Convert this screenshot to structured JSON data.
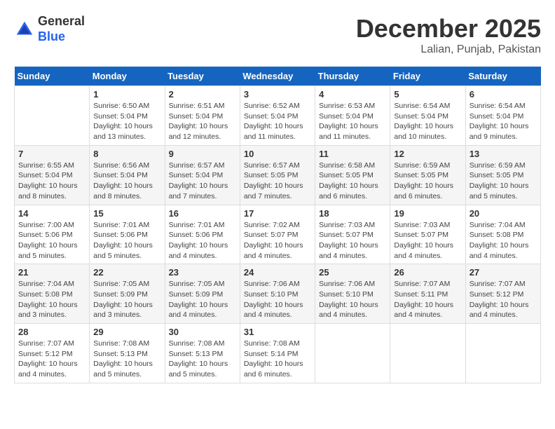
{
  "logo": {
    "general": "General",
    "blue": "Blue"
  },
  "header": {
    "month": "December 2025",
    "location": "Lalian, Punjab, Pakistan"
  },
  "days_of_week": [
    "Sunday",
    "Monday",
    "Tuesday",
    "Wednesday",
    "Thursday",
    "Friday",
    "Saturday"
  ],
  "weeks": [
    [
      {
        "day": "",
        "info": ""
      },
      {
        "day": "1",
        "info": "Sunrise: 6:50 AM\nSunset: 5:04 PM\nDaylight: 10 hours\nand 13 minutes."
      },
      {
        "day": "2",
        "info": "Sunrise: 6:51 AM\nSunset: 5:04 PM\nDaylight: 10 hours\nand 12 minutes."
      },
      {
        "day": "3",
        "info": "Sunrise: 6:52 AM\nSunset: 5:04 PM\nDaylight: 10 hours\nand 11 minutes."
      },
      {
        "day": "4",
        "info": "Sunrise: 6:53 AM\nSunset: 5:04 PM\nDaylight: 10 hours\nand 11 minutes."
      },
      {
        "day": "5",
        "info": "Sunrise: 6:54 AM\nSunset: 5:04 PM\nDaylight: 10 hours\nand 10 minutes."
      },
      {
        "day": "6",
        "info": "Sunrise: 6:54 AM\nSunset: 5:04 PM\nDaylight: 10 hours\nand 9 minutes."
      }
    ],
    [
      {
        "day": "7",
        "info": "Sunrise: 6:55 AM\nSunset: 5:04 PM\nDaylight: 10 hours\nand 8 minutes."
      },
      {
        "day": "8",
        "info": "Sunrise: 6:56 AM\nSunset: 5:04 PM\nDaylight: 10 hours\nand 8 minutes."
      },
      {
        "day": "9",
        "info": "Sunrise: 6:57 AM\nSunset: 5:04 PM\nDaylight: 10 hours\nand 7 minutes."
      },
      {
        "day": "10",
        "info": "Sunrise: 6:57 AM\nSunset: 5:05 PM\nDaylight: 10 hours\nand 7 minutes."
      },
      {
        "day": "11",
        "info": "Sunrise: 6:58 AM\nSunset: 5:05 PM\nDaylight: 10 hours\nand 6 minutes."
      },
      {
        "day": "12",
        "info": "Sunrise: 6:59 AM\nSunset: 5:05 PM\nDaylight: 10 hours\nand 6 minutes."
      },
      {
        "day": "13",
        "info": "Sunrise: 6:59 AM\nSunset: 5:05 PM\nDaylight: 10 hours\nand 5 minutes."
      }
    ],
    [
      {
        "day": "14",
        "info": "Sunrise: 7:00 AM\nSunset: 5:06 PM\nDaylight: 10 hours\nand 5 minutes."
      },
      {
        "day": "15",
        "info": "Sunrise: 7:01 AM\nSunset: 5:06 PM\nDaylight: 10 hours\nand 5 minutes."
      },
      {
        "day": "16",
        "info": "Sunrise: 7:01 AM\nSunset: 5:06 PM\nDaylight: 10 hours\nand 4 minutes."
      },
      {
        "day": "17",
        "info": "Sunrise: 7:02 AM\nSunset: 5:07 PM\nDaylight: 10 hours\nand 4 minutes."
      },
      {
        "day": "18",
        "info": "Sunrise: 7:03 AM\nSunset: 5:07 PM\nDaylight: 10 hours\nand 4 minutes."
      },
      {
        "day": "19",
        "info": "Sunrise: 7:03 AM\nSunset: 5:07 PM\nDaylight: 10 hours\nand 4 minutes."
      },
      {
        "day": "20",
        "info": "Sunrise: 7:04 AM\nSunset: 5:08 PM\nDaylight: 10 hours\nand 4 minutes."
      }
    ],
    [
      {
        "day": "21",
        "info": "Sunrise: 7:04 AM\nSunset: 5:08 PM\nDaylight: 10 hours\nand 3 minutes."
      },
      {
        "day": "22",
        "info": "Sunrise: 7:05 AM\nSunset: 5:09 PM\nDaylight: 10 hours\nand 3 minutes."
      },
      {
        "day": "23",
        "info": "Sunrise: 7:05 AM\nSunset: 5:09 PM\nDaylight: 10 hours\nand 4 minutes."
      },
      {
        "day": "24",
        "info": "Sunrise: 7:06 AM\nSunset: 5:10 PM\nDaylight: 10 hours\nand 4 minutes."
      },
      {
        "day": "25",
        "info": "Sunrise: 7:06 AM\nSunset: 5:10 PM\nDaylight: 10 hours\nand 4 minutes."
      },
      {
        "day": "26",
        "info": "Sunrise: 7:07 AM\nSunset: 5:11 PM\nDaylight: 10 hours\nand 4 minutes."
      },
      {
        "day": "27",
        "info": "Sunrise: 7:07 AM\nSunset: 5:12 PM\nDaylight: 10 hours\nand 4 minutes."
      }
    ],
    [
      {
        "day": "28",
        "info": "Sunrise: 7:07 AM\nSunset: 5:12 PM\nDaylight: 10 hours\nand 4 minutes."
      },
      {
        "day": "29",
        "info": "Sunrise: 7:08 AM\nSunset: 5:13 PM\nDaylight: 10 hours\nand 5 minutes."
      },
      {
        "day": "30",
        "info": "Sunrise: 7:08 AM\nSunset: 5:13 PM\nDaylight: 10 hours\nand 5 minutes."
      },
      {
        "day": "31",
        "info": "Sunrise: 7:08 AM\nSunset: 5:14 PM\nDaylight: 10 hours\nand 6 minutes."
      },
      {
        "day": "",
        "info": ""
      },
      {
        "day": "",
        "info": ""
      },
      {
        "day": "",
        "info": ""
      }
    ]
  ]
}
